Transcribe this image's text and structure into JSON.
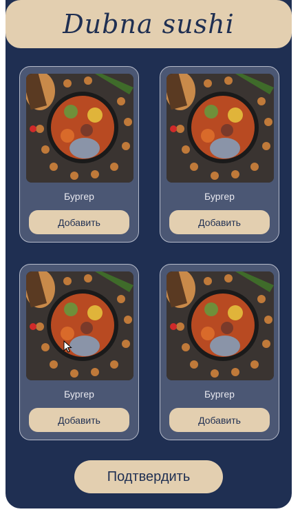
{
  "header": {
    "title": "Dubna sushi"
  },
  "products": [
    {
      "name": "Бургер",
      "add_label": "Добавить"
    },
    {
      "name": "Бургер",
      "add_label": "Добавить"
    },
    {
      "name": "Бургер",
      "add_label": "Добавить"
    },
    {
      "name": "Бургер",
      "add_label": "Добавить"
    }
  ],
  "footer": {
    "confirm_label": "Подтвердить"
  },
  "colors": {
    "background": "#1f2f52",
    "accent": "#e3cfb0",
    "card": "#4b5774"
  }
}
